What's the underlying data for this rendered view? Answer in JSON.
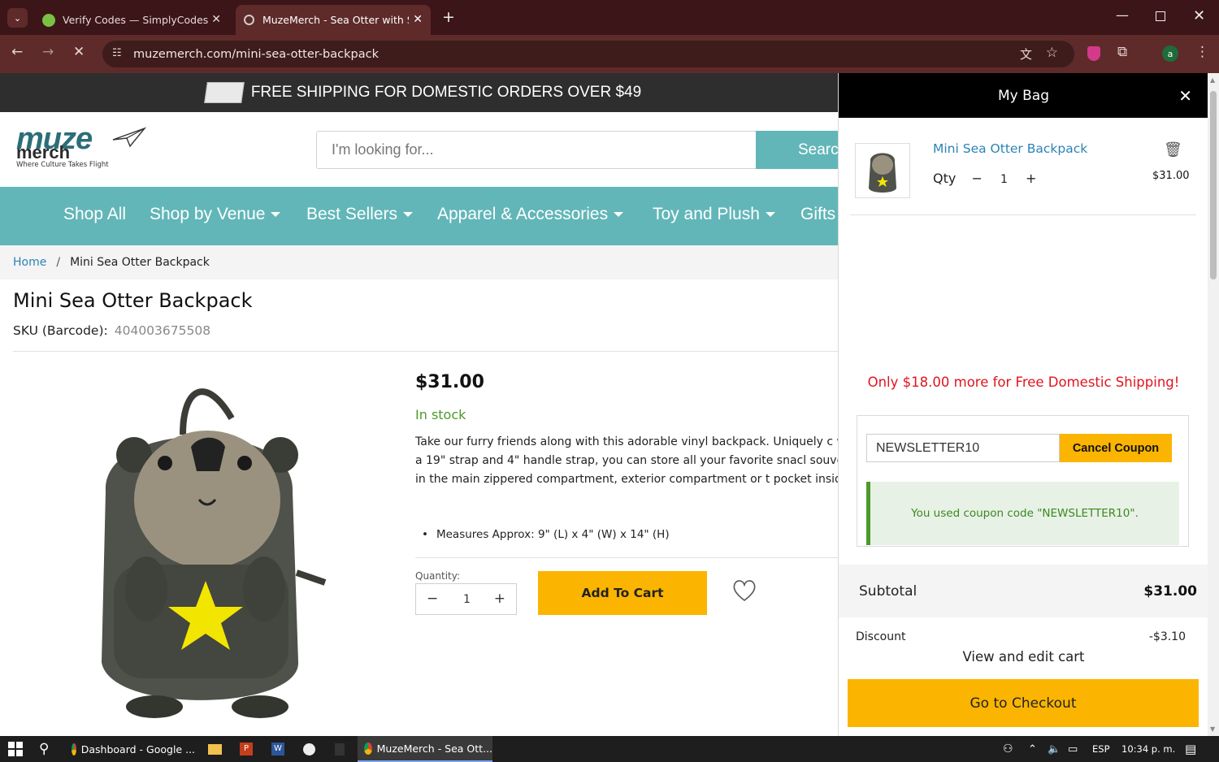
{
  "browser": {
    "tabs": [
      {
        "title": "Verify Codes — SimplyCodes"
      },
      {
        "title": "MuzeMerch - Sea Otter with Se"
      }
    ],
    "url": "muzemerch.com/mini-sea-otter-backpack"
  },
  "site": {
    "shipping_banner": "FREE SHIPPING FOR DOMESTIC ORDERS OVER $49",
    "logo_top": "muze",
    "logo_bottom": "merch",
    "logo_tagline": "Where Culture Takes Flight",
    "search_placeholder": "I'm looking for...",
    "search_button": "Search",
    "nav": [
      "Shop All",
      "Shop by Venue",
      "Best Sellers",
      "Apparel & Accessories",
      "Toy and Plush",
      "Gifts"
    ],
    "breadcrumb": {
      "home": "Home",
      "separator": "/",
      "current": "Mini Sea Otter Backpack"
    }
  },
  "product": {
    "title": "Mini Sea Otter Backpack",
    "sku_label": "SKU (Barcode):",
    "sku_value": "404003675508",
    "price": "$31.00",
    "stock": "In stock",
    "description": "Take our furry friends along with this adorable vinyl backpack. Uniquely c with a 19\" strap and 4\" handle strap, you can store all your favorite snacl souvenirs in the main zippered compartment, exterior compartment or t pocket inside.",
    "bullet": "Measures Approx: 9\" (L) x 4\" (W) x 14\" (H)",
    "quantity_label": "Quantity:",
    "quantity": "1",
    "add_to_cart": "Add To Cart"
  },
  "cart": {
    "title": "My Bag",
    "item_name": "Mini Sea Otter Backpack",
    "qty_label": "Qty",
    "qty_minus": "−",
    "qty_value": "1",
    "qty_plus": "+",
    "item_price": "$31.00",
    "free_shipping_msg": "Only $18.00 more for Free Domestic Shipping!",
    "coupon_code": "NEWSLETTER10",
    "cancel_coupon": "Cancel Coupon",
    "coupon_msg": "You used coupon code \"NEWSLETTER10\".",
    "subtotal_label": "Subtotal",
    "subtotal_value": "$31.00",
    "discount_label": "Discount",
    "discount_value": "-$3.10",
    "view_cart": "View and edit cart",
    "checkout": "Go to Checkout"
  },
  "taskbar": {
    "items": [
      "Dashboard - Google ...",
      "MuzeMerch - Sea Ott..."
    ],
    "lang": "ESP",
    "time": "10:34 p. m."
  },
  "colors": {
    "accent": "#fbb500",
    "nav": "#62b6b8",
    "link": "#2b84b5",
    "alert": "#e0141e",
    "stock": "#4c9a2a"
  }
}
